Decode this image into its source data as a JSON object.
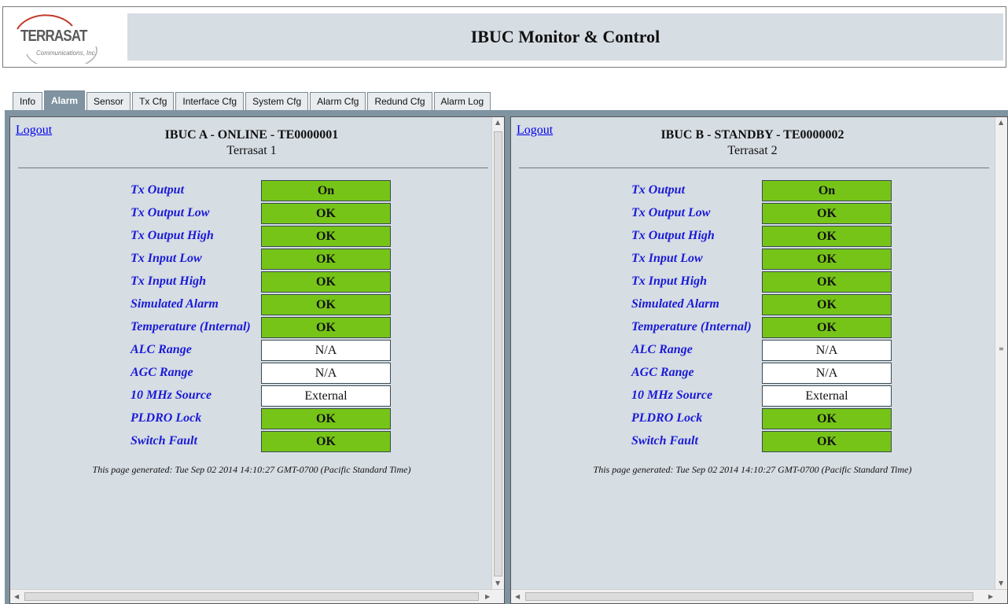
{
  "header": {
    "logo_text": "TERRASAT",
    "logo_sub": "Communications, Inc.",
    "title": "IBUC Monitor & Control"
  },
  "tabs": [
    {
      "label": "Info",
      "active": false
    },
    {
      "label": "Alarm",
      "active": true
    },
    {
      "label": "Sensor",
      "active": false
    },
    {
      "label": "Tx Cfg",
      "active": false
    },
    {
      "label": "Interface Cfg",
      "active": false
    },
    {
      "label": "System Cfg",
      "active": false
    },
    {
      "label": "Alarm Cfg",
      "active": false
    },
    {
      "label": "Redund Cfg",
      "active": false
    },
    {
      "label": "Alarm Log",
      "active": false
    }
  ],
  "colors": {
    "ok_green": "#76c418",
    "label_blue": "#1a1ad6",
    "title_bg": "#d6dde3",
    "frame_bg": "#7f93a1"
  },
  "panes": [
    {
      "logout": "Logout",
      "title": "IBUC A - ONLINE - TE0000001",
      "name": "Terrasat 1",
      "rows": [
        {
          "label": "Tx Output",
          "value": "On",
          "status": "green"
        },
        {
          "label": "Tx Output Low",
          "value": "OK",
          "status": "green"
        },
        {
          "label": "Tx Output High",
          "value": "OK",
          "status": "green"
        },
        {
          "label": "Tx Input Low",
          "value": "OK",
          "status": "green"
        },
        {
          "label": "Tx Input High",
          "value": "OK",
          "status": "green"
        },
        {
          "label": "Simulated Alarm",
          "value": "OK",
          "status": "green"
        },
        {
          "label": "Temperature (Internal)",
          "value": "OK",
          "status": "green"
        },
        {
          "label": "ALC Range",
          "value": "N/A",
          "status": "white"
        },
        {
          "label": "AGC Range",
          "value": "N/A",
          "status": "white"
        },
        {
          "label": "10 MHz Source",
          "value": "External",
          "status": "white"
        },
        {
          "label": "PLDRO Lock",
          "value": "OK",
          "status": "green"
        },
        {
          "label": "Switch Fault",
          "value": "OK",
          "status": "green"
        }
      ],
      "generated": "This page generated: Tue Sep 02 2014 14:10:27 GMT-0700 (Pacific Standard Time)"
    },
    {
      "logout": "Logout",
      "title": "IBUC B - STANDBY - TE0000002",
      "name": "Terrasat 2",
      "rows": [
        {
          "label": "Tx Output",
          "value": "On",
          "status": "green"
        },
        {
          "label": "Tx Output Low",
          "value": "OK",
          "status": "green"
        },
        {
          "label": "Tx Output High",
          "value": "OK",
          "status": "green"
        },
        {
          "label": "Tx Input Low",
          "value": "OK",
          "status": "green"
        },
        {
          "label": "Tx Input High",
          "value": "OK",
          "status": "green"
        },
        {
          "label": "Simulated Alarm",
          "value": "OK",
          "status": "green"
        },
        {
          "label": "Temperature (Internal)",
          "value": "OK",
          "status": "green"
        },
        {
          "label": "ALC Range",
          "value": "N/A",
          "status": "white"
        },
        {
          "label": "AGC Range",
          "value": "N/A",
          "status": "white"
        },
        {
          "label": "10 MHz Source",
          "value": "External",
          "status": "white"
        },
        {
          "label": "PLDRO Lock",
          "value": "OK",
          "status": "green"
        },
        {
          "label": "Switch Fault",
          "value": "OK",
          "status": "green"
        }
      ],
      "generated": "This page generated: Tue Sep 02 2014 14:10:27 GMT-0700 (Pacific Standard Time)"
    }
  ]
}
